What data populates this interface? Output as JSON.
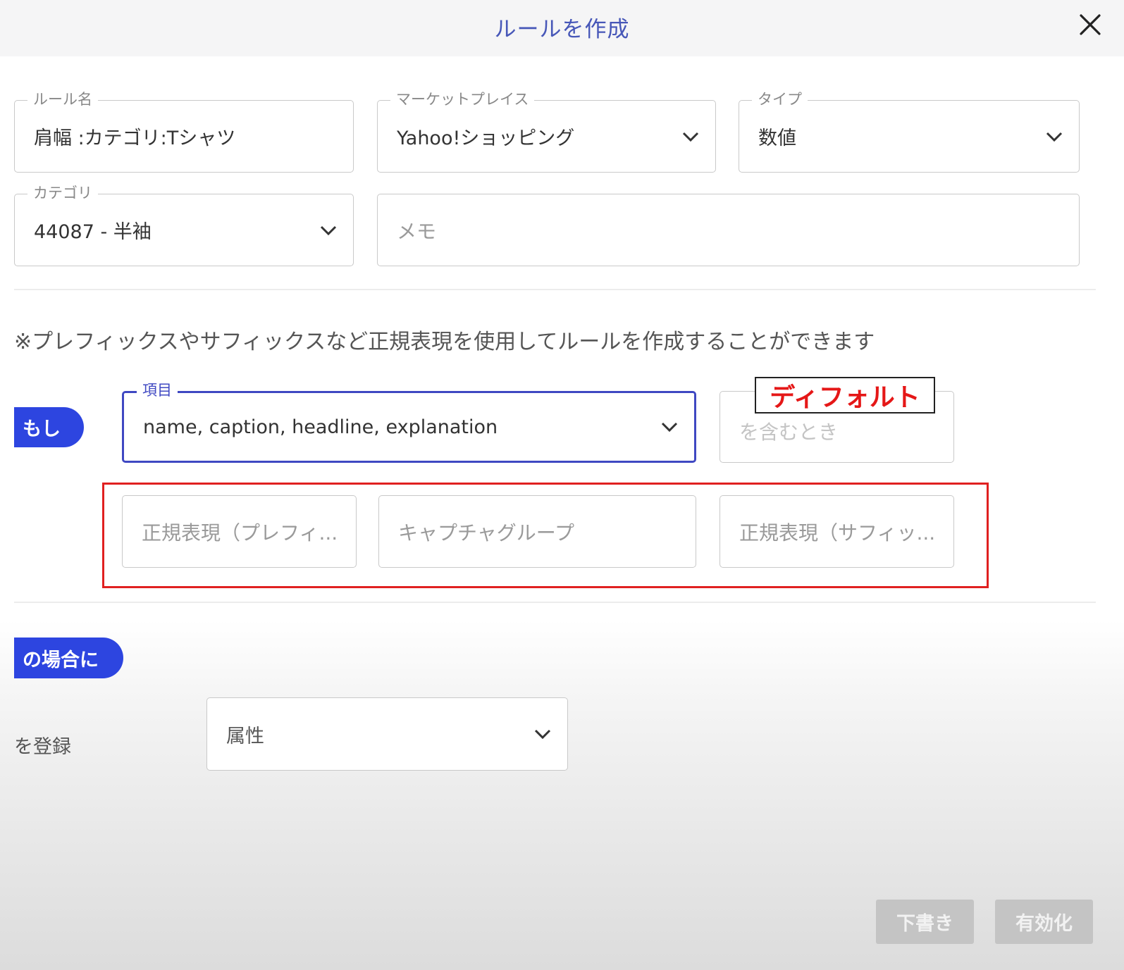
{
  "dialog": {
    "title": "ルールを作成",
    "close_icon": "close-icon"
  },
  "form": {
    "rule_name": {
      "label": "ルール名",
      "value": "肩幅 :カテゴリ:Tシャツ"
    },
    "marketplace": {
      "label": "マーケットプレイス",
      "value": "Yahoo!ショッピング"
    },
    "type": {
      "label": "タイプ",
      "value": "数値"
    },
    "category": {
      "label": "カテゴリ",
      "value": "44087 - 半袖"
    },
    "memo": {
      "placeholder": "メモ"
    }
  },
  "note": "※プレフィックスやサフィックスなど正規表現を使用してルールを作成することができます",
  "condition": {
    "if_label": "もし",
    "item": {
      "label": "項目",
      "value": "name, caption, headline, explanation"
    },
    "contains": {
      "placeholder": "を含むとき"
    },
    "default_annotation": "ディフォルト",
    "regex_prefix": {
      "placeholder": "正規表現（プレフィ..."
    },
    "capture_group": {
      "placeholder": "キャプチャグループ"
    },
    "regex_suffix": {
      "placeholder": "正規表現（サフィッ..."
    }
  },
  "action": {
    "then_label": "の場合に",
    "register_label": "を登録",
    "register_target": {
      "value": "属性"
    }
  },
  "footer": {
    "draft_label": "下書き",
    "enable_label": "有効化"
  },
  "colors": {
    "title": "#4757b8",
    "accent": "#2d45e0",
    "annotation": "#e02020",
    "disabled_button": "#c4c4c4"
  }
}
